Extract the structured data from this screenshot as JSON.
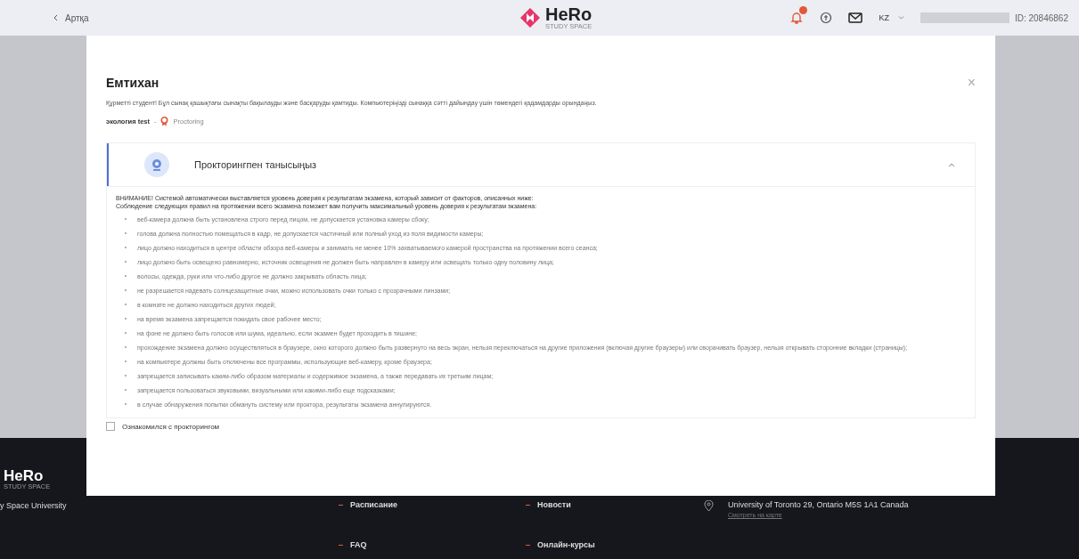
{
  "header": {
    "back_link": "Артқа",
    "logo_text": "HeRo",
    "logo_subtext": "STUDY SPACE",
    "notification_badge": true,
    "language": "KZ",
    "user_id": "ID: 20846862"
  },
  "modal": {
    "title": "Емтихан",
    "close": "×",
    "intro": "Құрметті студент! Бұл сынақ қашықтағы сынақты бақылауды және басқаруды қамтиды. Компьютеріңізді сынаққа сәтті дайындау үшін төмендегі қадамдарды орындаңыз.",
    "exam_name": "экология test",
    "separator": "-",
    "mode": "Proctoring",
    "accordion": {
      "title": "Прокторингпен танысыңыз",
      "expanded": true,
      "warning": [
        "ВНИМАНИЕ! Системой автоматически выставляется уровень доверия к результатам экзамена, который зависит от факторов, описанных ниже:",
        "Соблюдение следующих правил на протяжении всего экзамена поможет вам получить максимальный уровень доверия к результатам экзамена:"
      ],
      "rules": [
        "веб-камера должна быть установлена строго перед лицом, не допускается установка камеры сбоку;",
        "голова должна полностью помещаться в кадр, не допускается частичный или полный уход из поля видимости камеры;",
        "лицо должно находиться в центре области обзора веб-камеры и занимать не менее 10% захватываемого камерой пространства на протяжении всего сеанса;",
        "лицо должно быть освещено равномерно, источник освещения не должен быть направлен в камеру или освещать только одну половину лица;",
        "волосы, одежда, руки или что-либо другое не должно закрывать область лица;",
        "не разрешается надевать солнцезащитные очки, можно использовать очки только с прозрачными линзами;",
        "в комнате не должно находиться других людей;",
        "на время экзамена запрещается покидать свое рабочее место;",
        "на фоне не должно быть голосов или шума, идеально, если экзамен будет проходить в тишине;",
        "прохождение экзамена должно осуществляться в браузере, окно которого должно быть развернуто на весь экран, нельзя переключаться на другие приложения (включая другие браузеры) или сворачивать браузер, нельзя открывать сторонние вкладки (страницы);",
        "на компьютере должны быть отключены все программы, использующие веб-камеру, кроме браузера;",
        "запрещается записывать каким-либо образом материалы и содержимое экзамена, а также передавать их третьим лицам;",
        "запрещается пользоваться звуковыми, визуальными или какими-либо еще подсказками;",
        "в случае обнаружения попытки обмануть систему или проктора, результаты экзамена аннулируются."
      ]
    },
    "agree": {
      "label": "Ознакомился с прокторингом",
      "checked": false
    }
  },
  "footer": {
    "logo_text": "HeRo",
    "logo_subtext": "STUDY SPACE",
    "university": "y Space University",
    "links": [
      "Расписание",
      "Новости",
      "FAQ",
      "Онлайн-курсы"
    ],
    "address": "University of Toronto 29, Ontario M5S 1A1 Canada",
    "map_link": "Смотреть на карте"
  }
}
